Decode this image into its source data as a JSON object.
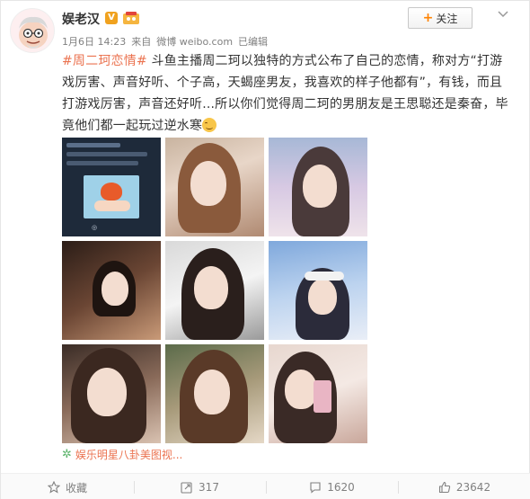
{
  "post": {
    "author": "娱老汉",
    "verified_mark": "V",
    "time": "1月6日 14:23",
    "source_prefix": "来自",
    "source": "微博 weibo.com",
    "edited": "已编辑",
    "follow_label": "关注",
    "topic": "#周二珂恋情#",
    "body": " 斗鱼主播周二珂以独特的方式公布了自己的恋情，称对方“打游戏厉害、声音好听、个子高，天蝎座男友，我喜欢的样子他都有”，有钱，而且打游戏厉害，声音还好听...所以你们觉得周二珂的男朋友是王思聪还是秦奋，毕竟他们都一起玩过逆水寒",
    "album_link": "娱乐明星八卦美图视..."
  },
  "actions": {
    "favorite_label": "收藏",
    "repost_count": "317",
    "comment_count": "1620",
    "like_count": "23642"
  },
  "colors": {
    "topic": "#eb7350",
    "follow_plus": "#ff8200",
    "verified": "#f0a21f"
  },
  "icons": [
    "avatar",
    "verified-icon",
    "level-badge-icon",
    "more-chevron-icon",
    "album-icon",
    "favorite-icon",
    "repost-icon",
    "comment-icon",
    "like-icon"
  ]
}
